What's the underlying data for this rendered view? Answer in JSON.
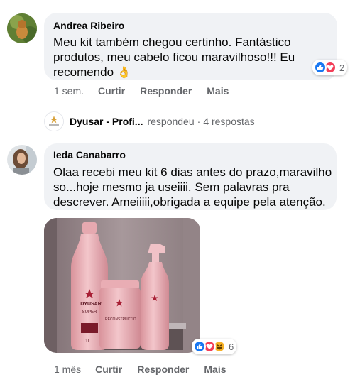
{
  "comments": [
    {
      "author": "Andrea Ribeiro",
      "text_lines": [
        "Meu kit também chegou certinho. Fantástico",
        "produtos, meu cabelo ficou maravilhoso!!! Eu",
        "recomendo"
      ],
      "emoji": "👌",
      "reaction_count": "2",
      "reactions": [
        "like-icon",
        "love-icon"
      ],
      "time": "1 sem.",
      "actions": [
        "Curtir",
        "Responder",
        "Mais"
      ]
    },
    {
      "author": "Ieda Canabarro",
      "text_lines": [
        "Olaa recebi meu kit 6 dias antes do prazo,maravilho",
        "so...hoje mesmo ja useiiii. Sem palavras pra",
        "descrever. Ameiiiii,obrigada a equipe pela atenção."
      ],
      "reaction_count": "6",
      "reactions": [
        "like-icon",
        "love-icon",
        "haha-icon"
      ],
      "time": "1 mês",
      "actions": [
        "Curtir",
        "Responder",
        "Mais"
      ],
      "photo": {
        "brand": "DYUSAR",
        "product_line": "SUPER",
        "product_line_2": "RECONSTRUCTION",
        "bottle_size_label": "1L"
      }
    }
  ],
  "reply_summary": {
    "page_name": "Dyusar - Profi...",
    "verb": "respondeu",
    "separator": "·",
    "count": "4 respostas"
  },
  "colors": {
    "bubble": "#f0f2f5",
    "like": "#1877f2",
    "love": "#f33e58",
    "haha": "#f7b125",
    "meta_text": "#65676b"
  }
}
